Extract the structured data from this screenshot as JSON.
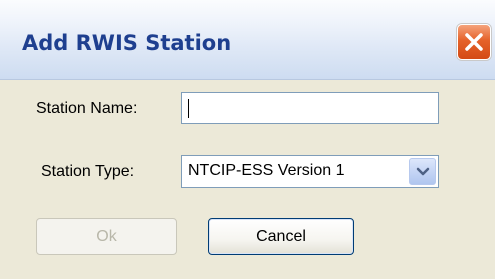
{
  "dialog": {
    "title": "Add RWIS Station",
    "close_icon": "close-icon"
  },
  "form": {
    "station_name_label": "Station Name:",
    "station_name_value": "",
    "station_type_label": "Station Type:",
    "station_type_value": "NTCIP-ESS Version 1",
    "dropdown_icon": "chevron-down-icon"
  },
  "buttons": {
    "ok_label": "Ok",
    "ok_enabled": false,
    "cancel_label": "Cancel"
  },
  "colors": {
    "title_text": "#1e3f8f",
    "close_button": "#e5622a",
    "dialog_background": "#ece9d8",
    "input_border": "#7f9db9",
    "disabled_text": "#b8b7a9"
  }
}
